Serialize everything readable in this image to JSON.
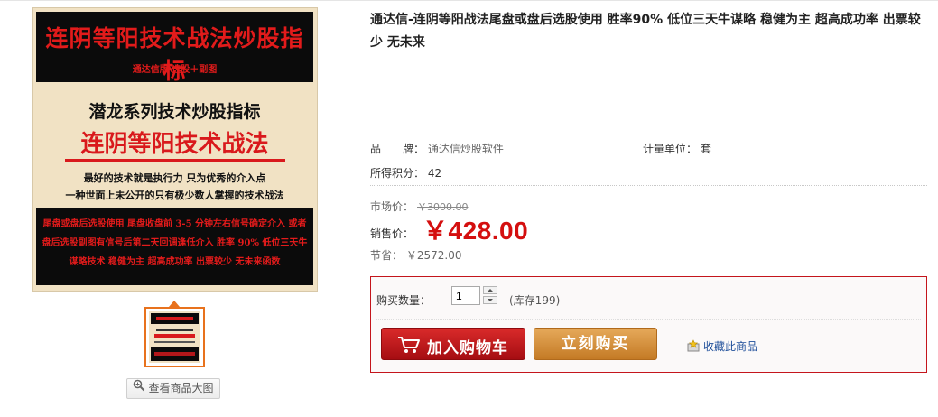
{
  "image": {
    "title_main": "连阴等阳技术战法炒股指标",
    "title_sub": "通达信版 选股＋副图",
    "series": "潜龙系列技术炒股指标",
    "headline": "连阴等阳技术战法",
    "line1": "最好的技术就是执行力 只为优秀的介入点",
    "line2": "一种世面上未公开的只有极少数人掌握的技术战法",
    "bottom_text": "尾盘或盘后选股使用 尾盘收盘前 3-5 分钟左右信号确定介入 或者盘后选股副图有信号后第二天回调逢低介入 胜率 90% 低位三天牛谋略技术 稳健为主 超高成功率 出票较少 无未来函数"
  },
  "gallery": {
    "view_big_label": "查看商品大图"
  },
  "product": {
    "title": "通达信-连阴等阳战法尾盘或盘后选股使用 胜率90% 低位三天牛谋略 稳健为主 超高成功率 出票较少 无未来",
    "brand_label": "品　　牌：",
    "brand_value": "通达信炒股软件",
    "unit_label": "计量单位：",
    "unit_value": "套",
    "points_label": "所得积分：",
    "points_value": "42",
    "market_label": "市场价：",
    "market_price": "￥3000.00",
    "sale_label": "销售价：",
    "sale_price": "￥428.00",
    "save_label": "节省：",
    "save_value": "￥2572.00"
  },
  "buy": {
    "qty_label": "购买数量：",
    "qty_value": "1",
    "stock": "(库存199)",
    "add_cart_label": "加入购物车",
    "buy_now_label": "立刻购买",
    "favorite_label": "收藏此商品"
  },
  "colors": {
    "price_red": "#d40f0f",
    "buybox_border": "#c4151c",
    "cart_button": "#c01a1e",
    "buy_button": "#d8913d",
    "link_blue": "#1f4f9a",
    "thumb_border": "#e8721d"
  }
}
